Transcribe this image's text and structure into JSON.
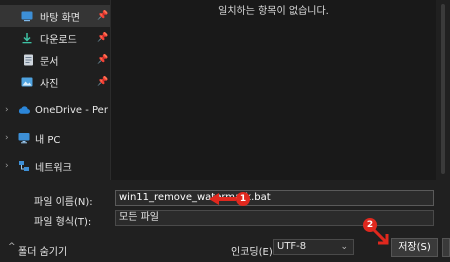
{
  "navigation": {
    "quick_access": [
      {
        "label": "바탕 화면"
      },
      {
        "label": "다운로드"
      },
      {
        "label": "문서"
      },
      {
        "label": "사진"
      }
    ],
    "tree": [
      {
        "label": "OneDrive - Persona"
      },
      {
        "label": "내 PC"
      },
      {
        "label": "네트워크"
      }
    ]
  },
  "content": {
    "empty_message": "일치하는 항목이 없습니다."
  },
  "form": {
    "filename_label": "파일 이름(N):",
    "filename_value": "win11_remove_watermark.bat",
    "filetype_label": "파일 형식(T):",
    "filetype_value": "모든 파일",
    "encoding_label": "인코딩(E):",
    "encoding_value": "UTF-8",
    "save_label": "저장(S)",
    "cancel_label": "",
    "hide_folders_label": "폴더 숨기기"
  },
  "annotations": {
    "step1": "1",
    "step2": "2",
    "accent_color": "#e0281e"
  },
  "colors": {
    "background": "#1c1c1c",
    "selected": "#353535",
    "folder_blue": "#4fa3e0"
  }
}
